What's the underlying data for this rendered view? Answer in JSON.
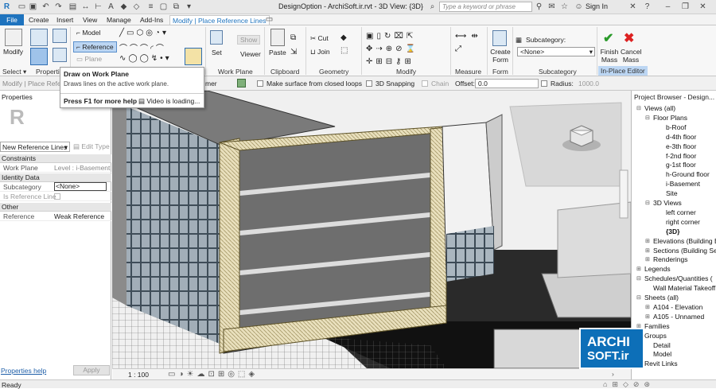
{
  "window": {
    "title": "DesignOption - ArchiSoft.ir.rvt - 3D View: {3D}",
    "sign_in": "Sign In"
  },
  "search": {
    "placeholder": "Type a keyword or phrase"
  },
  "tabs": [
    "File",
    "Create",
    "Insert",
    "View",
    "Manage",
    "Add-Ins",
    "Modify | Place Reference Lines"
  ],
  "ribbon": {
    "modify": "Modify",
    "model": "Model",
    "reference": "Reference",
    "plane": "Plane",
    "set": "Set",
    "show": "Show",
    "viewer": "Viewer",
    "paste": "Paste",
    "cut": "Cut",
    "join": "Join",
    "create_form": "Create Form",
    "subcategory": "Subcategory:",
    "subcategory_value": "<None>",
    "finish_mass": "Finish Mass",
    "cancel_mass": "Cancel Mass",
    "panels": {
      "select": "Select",
      "properties": "Propertie",
      "work_plane": "Work Plane",
      "clipboard": "Clipboard",
      "geometry": "Geometry",
      "modify": "Modify",
      "measure": "Measure",
      "form": "Form",
      "subcategory": "Subcategory",
      "in_place_editor": "In-Place Editor"
    }
  },
  "optbar": {
    "context": "Modify | Place Refere",
    "cut_text": "mer",
    "make_surface": "Make surface from closed loops",
    "snapping": "3D Snapping",
    "chain": "Chain",
    "offset_label": "Offset:",
    "offset_value": "0.0",
    "radius_label": "Radius:",
    "radius_value": "1000.0"
  },
  "tooltip": {
    "title": "Draw on Work Plane",
    "description": "Draws lines on the active work plane.",
    "help": "Press F1 for more help",
    "video": "Video is loading..."
  },
  "properties": {
    "header": "Properties",
    "type": "New Reference Lines",
    "edit_type": "Edit Type",
    "groups": [
      {
        "name": "Constraints",
        "rows": [
          {
            "k": "Work Plane",
            "v": "Level : i-Basement"
          }
        ]
      },
      {
        "name": "Identity Data",
        "rows": [
          {
            "k": "Subcategory",
            "v": "<None>"
          },
          {
            "k": "Is Reference Line",
            "v": ""
          }
        ]
      },
      {
        "name": "Other",
        "rows": [
          {
            "k": "Reference",
            "v": "Weak Reference"
          }
        ]
      }
    ],
    "help_link": "Properties help",
    "apply": "Apply"
  },
  "viewbar": {
    "scale": "1 : 100"
  },
  "browser": {
    "title": "Project Browser - Design...",
    "items": [
      {
        "label": "Views (all)",
        "level": 0,
        "exp": "⊟"
      },
      {
        "label": "Floor Plans",
        "level": 1,
        "exp": "⊟"
      },
      {
        "label": "b-Roof",
        "level": 2
      },
      {
        "label": "d-4th floor",
        "level": 2
      },
      {
        "label": "e-3th floor",
        "level": 2
      },
      {
        "label": "f-2nd floor",
        "level": 2
      },
      {
        "label": "g-1st floor",
        "level": 2
      },
      {
        "label": "h-Ground floor",
        "level": 2
      },
      {
        "label": "i-Basement",
        "level": 2
      },
      {
        "label": "Site",
        "level": 2
      },
      {
        "label": "3D Views",
        "level": 1,
        "exp": "⊟"
      },
      {
        "label": "left corner",
        "level": 2
      },
      {
        "label": "right corner",
        "level": 2
      },
      {
        "label": "{3D}",
        "level": 2,
        "bold": true
      },
      {
        "label": "Elevations (Building E",
        "level": 1,
        "exp": "⊞"
      },
      {
        "label": "Sections (Building Sec",
        "level": 1,
        "exp": "⊞"
      },
      {
        "label": "Renderings",
        "level": 1,
        "exp": "⊞"
      },
      {
        "label": "Legends",
        "level": 0,
        "exp": "⊞"
      },
      {
        "label": "Schedules/Quantities (",
        "level": 0,
        "exp": "⊟"
      },
      {
        "label": "Wall Material Takeoff",
        "level": 1
      },
      {
        "label": "Sheets (all)",
        "level": 0,
        "exp": "⊟"
      },
      {
        "label": "A104 - Elevation",
        "level": 1,
        "exp": "⊞"
      },
      {
        "label": "A105 - Unnamed",
        "level": 1,
        "exp": "⊞"
      },
      {
        "label": "Families",
        "level": 0,
        "exp": "⊞"
      },
      {
        "label": "Groups",
        "level": 0,
        "exp": "⊞"
      },
      {
        "label": "Detail",
        "level": 1
      },
      {
        "label": "Model",
        "level": 1
      },
      {
        "label": "Revit Links",
        "level": 0,
        "exp": "⊞"
      }
    ]
  },
  "logo": {
    "line1": "ARCHI",
    "line2": "SOFT.ir"
  },
  "status": {
    "text": "Ready"
  },
  "colors": {
    "accent": "#1e73be",
    "tab_bg": "#f3f3f3",
    "building_face": "#6e6e6e"
  }
}
